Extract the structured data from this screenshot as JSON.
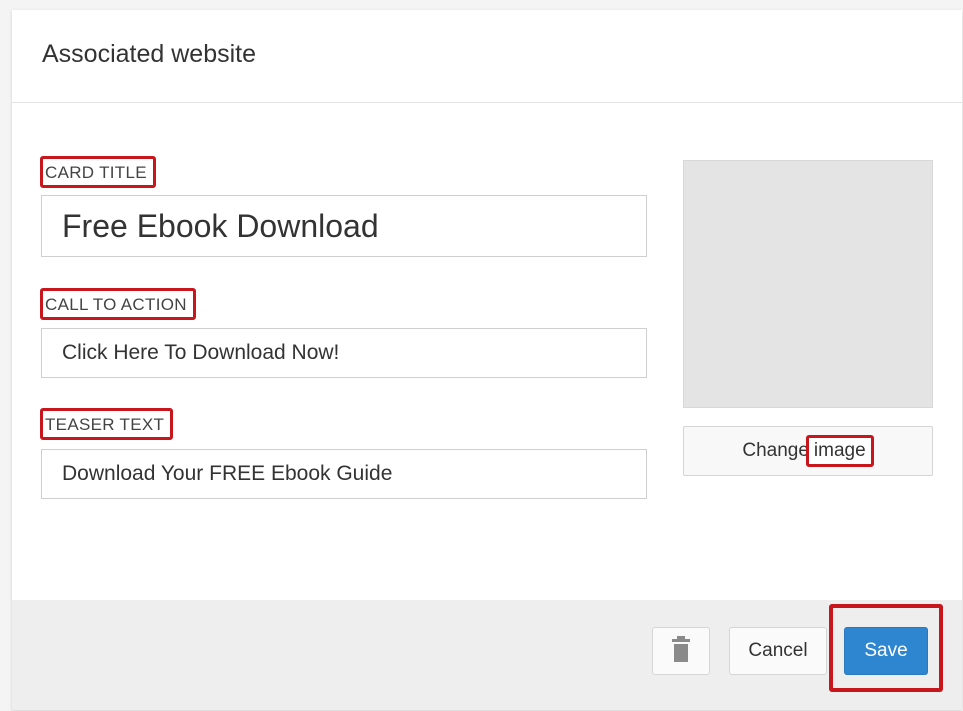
{
  "dialog": {
    "title": "Associated website"
  },
  "form": {
    "card_title": {
      "label": "CARD TITLE",
      "value": "Free Ebook Download"
    },
    "call_to_action": {
      "label": "CALL TO ACTION",
      "value": "Click Here To Download Now!"
    },
    "teaser_text": {
      "label": "TEASER TEXT",
      "value": "Download Your FREE Ebook Guide"
    }
  },
  "image": {
    "change_prefix": "Change",
    "change_suffix": "image"
  },
  "footer": {
    "delete_icon": "trash-icon",
    "cancel_label": "Cancel",
    "save_label": "Save"
  },
  "colors": {
    "highlight": "#c8161d",
    "primary": "#2f86d0"
  }
}
